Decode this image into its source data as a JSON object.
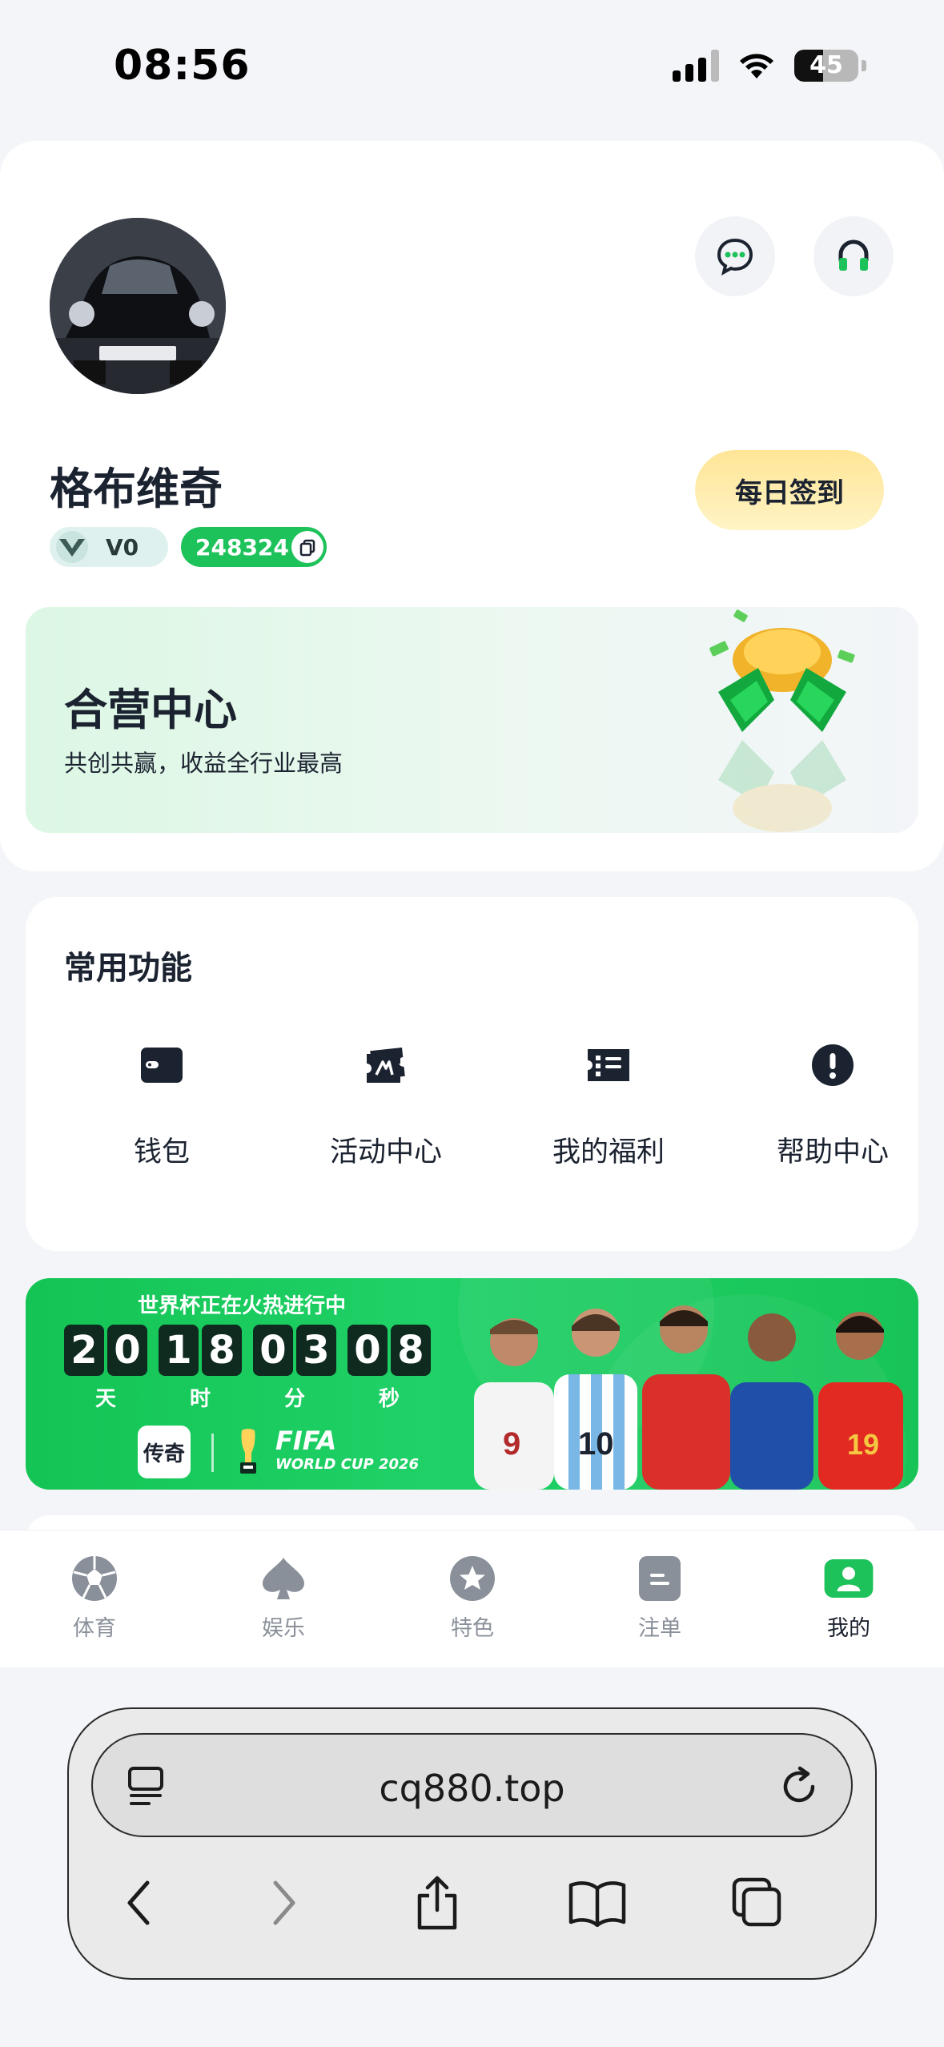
{
  "status_bar": {
    "time": "08:56",
    "battery": "45",
    "battery_level": 0.45
  },
  "profile": {
    "username": "格布维奇",
    "vip_level": "V0",
    "user_id": "248324",
    "checkin_label": "每日签到"
  },
  "partner_banner": {
    "title": "合营中心",
    "subtitle": "共创共赢，收益全行业最高"
  },
  "features": {
    "title": "常用功能",
    "items": [
      {
        "label": "钱包",
        "icon": "wallet-icon"
      },
      {
        "label": "活动中心",
        "icon": "ticket-icon"
      },
      {
        "label": "我的福利",
        "icon": "coupon-icon"
      },
      {
        "label": "帮助中心",
        "icon": "exclamation-icon"
      }
    ]
  },
  "worldcup_banner": {
    "headline": "世界杯正在火热进行中",
    "countdown": {
      "days": [
        "2",
        "0"
      ],
      "hours": [
        "1",
        "8"
      ],
      "minutes": [
        "0",
        "3"
      ],
      "seconds": [
        "0",
        "8"
      ]
    },
    "units": [
      "天",
      "时",
      "分",
      "秒"
    ],
    "brand_logo_text": "传奇",
    "fifa_text": "FIFA",
    "worldcup_text": "WORLD CUP 2026"
  },
  "tab_bar": {
    "tabs": [
      {
        "label": "体育",
        "icon": "soccer-ball-icon"
      },
      {
        "label": "娱乐",
        "icon": "spade-icon"
      },
      {
        "label": "特色",
        "icon": "star-badge-icon"
      },
      {
        "label": "注单",
        "icon": "bet-slip-icon"
      },
      {
        "label": "我的",
        "icon": "user-icon"
      }
    ],
    "active_tab": "我的"
  },
  "browser": {
    "url": "cq880.top"
  },
  "colors": {
    "brand_green": "#1ec25b",
    "checkin_yellow": "#ffe596",
    "text_dark": "#1b2230",
    "tab_inactive": "#8a909a"
  }
}
